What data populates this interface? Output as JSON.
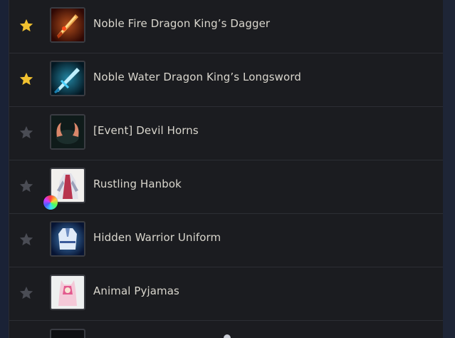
{
  "colors": {
    "star_active": "#f2c230",
    "star_inactive": "#4a4c54",
    "text": "#d9d6cd"
  },
  "items": [
    {
      "name": "Noble Fire Dragon King’s Dagger",
      "favorite": true,
      "icon": "fire-dagger-icon",
      "dye": false
    },
    {
      "name": "Noble Water Dragon King’s Longsword",
      "favorite": true,
      "icon": "water-longsword-icon",
      "dye": false
    },
    {
      "name": "[Event] Devil Horns",
      "favorite": false,
      "icon": "devil-horns-icon",
      "dye": false
    },
    {
      "name": "Rustling Hanbok",
      "favorite": false,
      "icon": "hanbok-icon",
      "dye": true
    },
    {
      "name": "Hidden Warrior Uniform",
      "favorite": false,
      "icon": "warrior-uniform-icon",
      "dye": false
    },
    {
      "name": "Animal Pyjamas",
      "favorite": false,
      "icon": "animal-pyjamas-icon",
      "dye": false
    }
  ]
}
